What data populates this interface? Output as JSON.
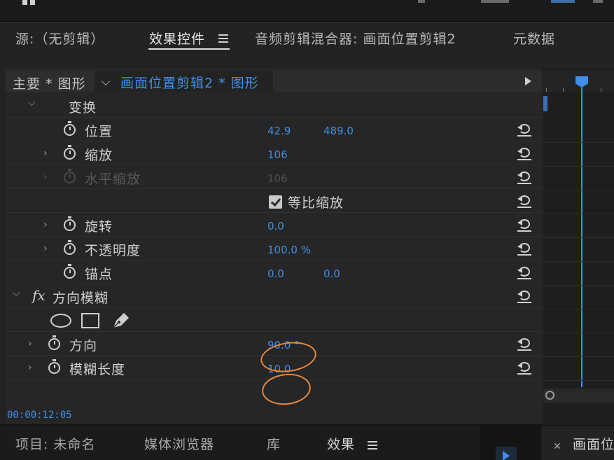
{
  "tabs": {
    "source": "源:（无剪辑）",
    "effect_controls": "效果控件",
    "audio_mixer": "音频剪辑混合器: 画面位置剪辑2",
    "metadata": "元数据"
  },
  "header": {
    "master": "主要 * 图形",
    "clip": "画面位置剪辑2 * 图形"
  },
  "transform": {
    "title": "变换",
    "position": {
      "label": "位置",
      "x": "42.9",
      "y": "489.0"
    },
    "scale": {
      "label": "缩放",
      "value": "106"
    },
    "scale_width": {
      "label": "水平缩放",
      "value": "106"
    },
    "uniform": {
      "label": "等比缩放",
      "checked": true
    },
    "rotation": {
      "label": "旋转",
      "value": "0.0"
    },
    "opacity": {
      "label": "不透明度",
      "value": "100.0 %"
    },
    "anchor": {
      "label": "锚点",
      "x": "0.0",
      "y": "0.0"
    }
  },
  "blur": {
    "fx": "fx",
    "title": "方向模糊",
    "direction": {
      "label": "方向",
      "value": "90.0 °"
    },
    "length": {
      "label": "模糊长度",
      "value": "10.0"
    }
  },
  "timecode": "00:00:12:05",
  "bottom_tabs": {
    "project": "项目: 未命名",
    "media_browser": "媒体浏览器",
    "library": "库",
    "effects": "效果",
    "right_panel": "画面位"
  },
  "colors": {
    "accent": "#3f8fe8",
    "annotation": "#e8873a"
  }
}
